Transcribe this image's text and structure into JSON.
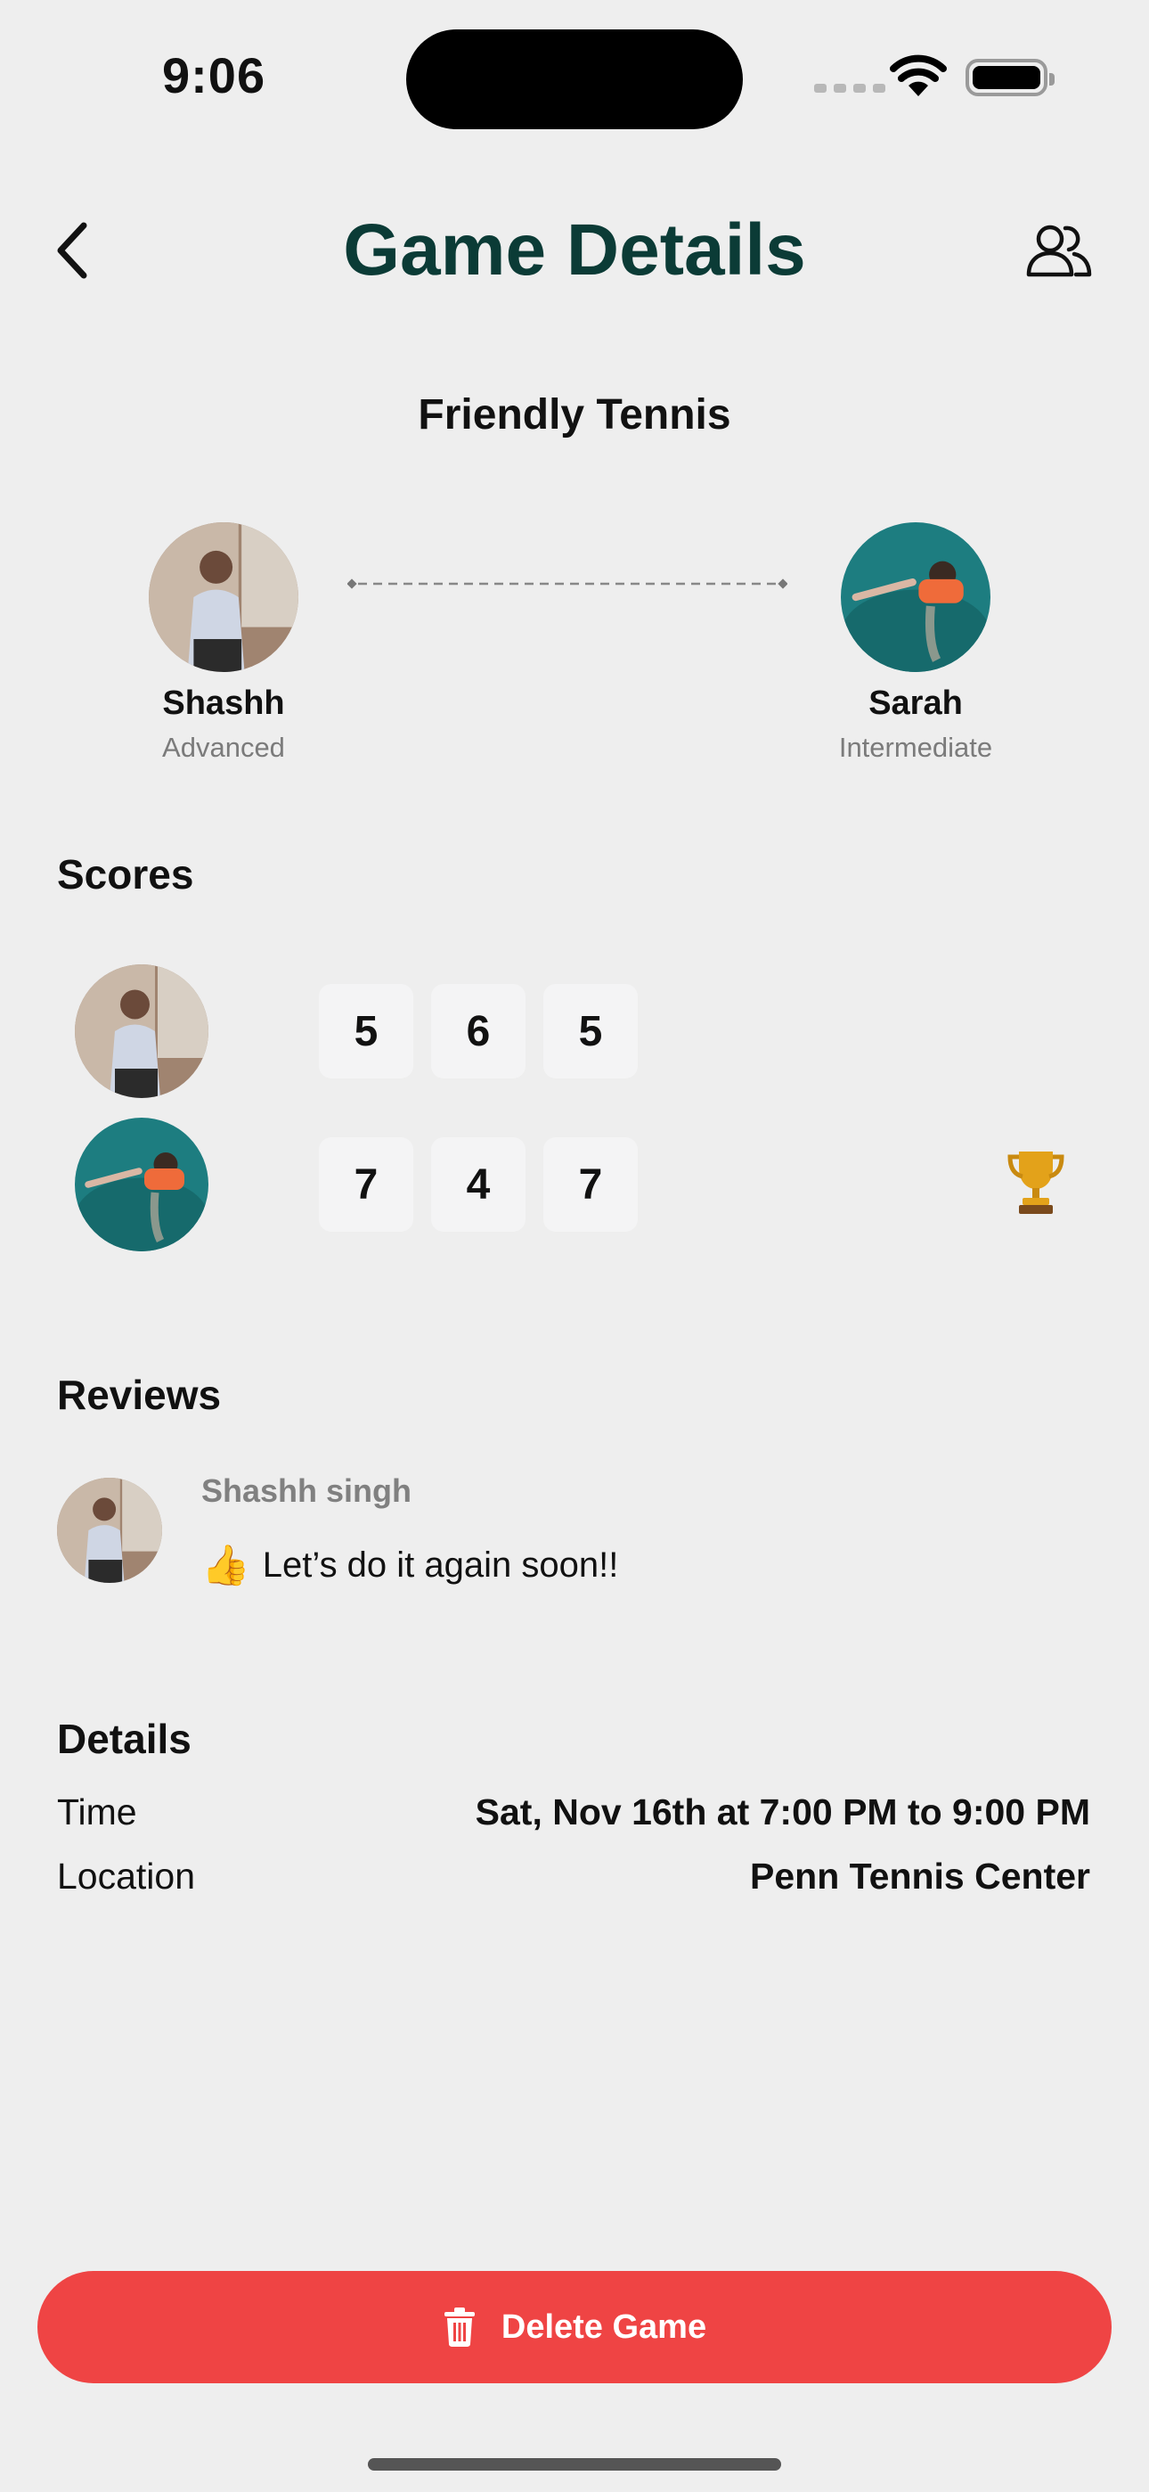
{
  "status_bar": {
    "time": "9:06"
  },
  "header": {
    "title": "Game Details",
    "back_icon": "chevron-left-icon",
    "people_icon": "people-icon"
  },
  "game": {
    "name": "Friendly Tennis"
  },
  "players": [
    {
      "name": "Shashh",
      "level": "Advanced"
    },
    {
      "name": "Sarah",
      "level": "Intermediate"
    }
  ],
  "scores": {
    "title": "Scores",
    "rows": [
      {
        "player": "Shashh",
        "sets": [
          "5",
          "6",
          "5"
        ],
        "winner": false
      },
      {
        "player": "Sarah",
        "sets": [
          "7",
          "4",
          "7"
        ],
        "winner": true
      }
    ],
    "trophy": "🏆"
  },
  "reviews": {
    "title": "Reviews",
    "items": [
      {
        "author": "Shashh singh",
        "emoji": "👍",
        "text": "Let’s do it again soon!!"
      }
    ]
  },
  "details": {
    "title": "Details",
    "time_label": "Time",
    "time_value": "Sat, Nov 16th at 7:00 PM to 9:00 PM",
    "location_label": "Location",
    "location_value": "Penn Tennis Center"
  },
  "actions": {
    "delete_label": "Delete Game",
    "delete_color": "#ef4444"
  },
  "colors": {
    "title": "#0b3b36",
    "background": "#eeeeee"
  }
}
